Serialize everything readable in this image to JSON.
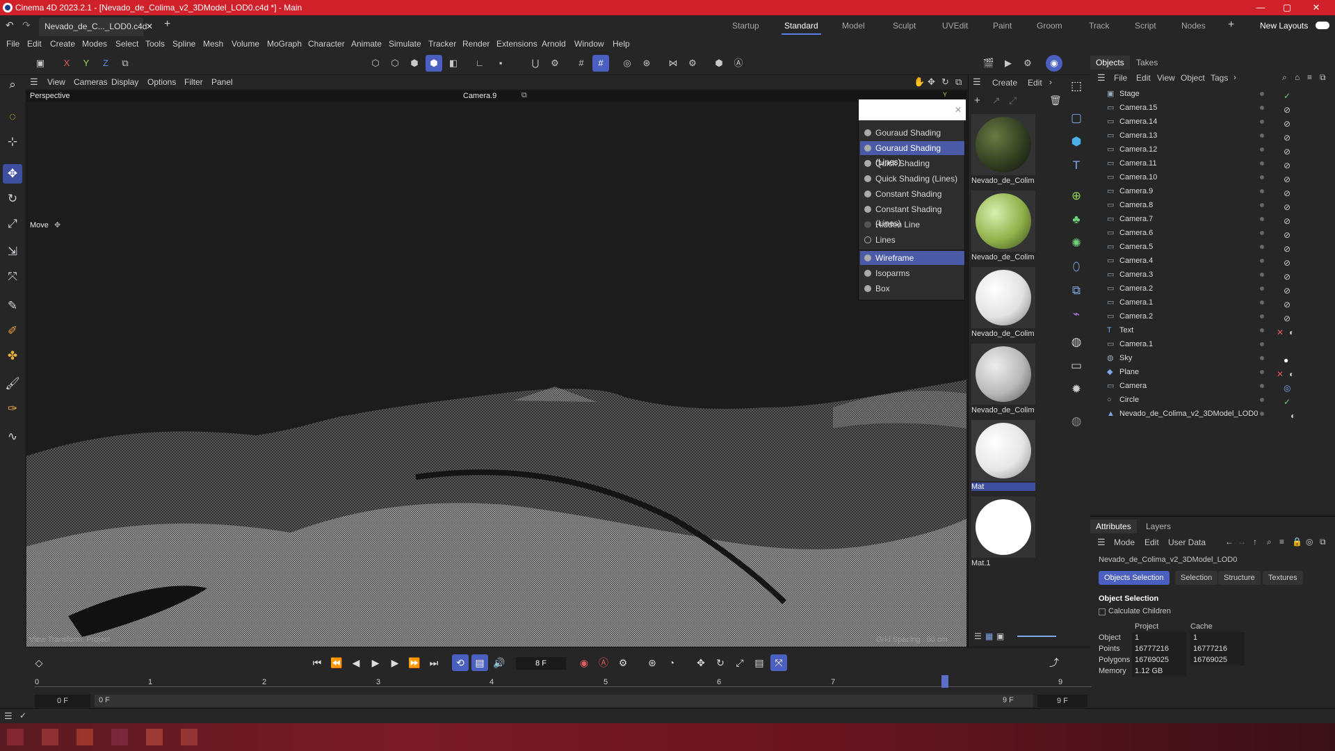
{
  "titlebar": {
    "title": "Cinema 4D 2023.2.1 - [Nevado_de_Colima_v2_3DModel_LOD0.c4d *] - Main"
  },
  "tabs": {
    "document": "Nevado_de_C..._LOD0.c4d *",
    "layouts": [
      "Startup",
      "Standard",
      "Model",
      "Sculpt",
      "UVEdit",
      "Paint",
      "Groom",
      "Track",
      "Script",
      "Nodes"
    ],
    "active_layout": "Standard",
    "new_layouts": "New Layouts"
  },
  "menu": [
    "File",
    "Edit",
    "Create",
    "Modes",
    "Select",
    "Tools",
    "Spline",
    "Mesh",
    "Volume",
    "MoGraph",
    "Character",
    "Animate",
    "Simulate",
    "Tracker",
    "Render",
    "Extensions",
    "Arnold",
    "Window",
    "Help"
  ],
  "axis": {
    "x": "X",
    "y": "Y",
    "z": "Z"
  },
  "viewport": {
    "menu": [
      "View",
      "Cameras",
      "Display",
      "Options",
      "Filter",
      "Panel"
    ],
    "view_name": "Perspective",
    "camera": "Camera.9",
    "tool": "Move",
    "bottom_left": "View Transform: Project",
    "bottom_right": "Grid Spacing : 50 cm"
  },
  "shading_menu": {
    "items": [
      "Gouraud Shading",
      "Gouraud Shading (Lines)",
      "Quick Shading",
      "Quick Shading (Lines)",
      "Constant Shading",
      "Constant Shading (Lines)",
      "Hidden Line",
      "Lines",
      "Wireframe",
      "Isoparms",
      "Box"
    ],
    "selected": [
      "Gouraud Shading (Lines)",
      "Wireframe"
    ]
  },
  "materials": {
    "menu": [
      "Create",
      "Edit"
    ],
    "items": [
      {
        "name": "Nevado_de_Colim",
        "color": "#3b4a2a"
      },
      {
        "name": "Nevado_de_Colim",
        "color": "#8fb04a"
      },
      {
        "name": "Nevado_de_Colim",
        "color": "#e2e2e2"
      },
      {
        "name": "Nevado_de_Colim",
        "color": "#b8b8b8"
      },
      {
        "name": "Mat",
        "color": "#f0f0f0"
      },
      {
        "name": "Mat.1",
        "color": "#ffffff"
      }
    ],
    "selected": "Mat"
  },
  "objects": {
    "tabs": [
      "Objects",
      "Takes"
    ],
    "menu": [
      "File",
      "Edit",
      "View",
      "Object",
      "Tags"
    ],
    "rows": [
      "Stage",
      "Camera.15",
      "Camera.14",
      "Camera.13",
      "Camera.12",
      "Camera.11",
      "Camera.10",
      "Camera.9",
      "Camera.8",
      "Camera.7",
      "Camera.6",
      "Camera.5",
      "Camera.4",
      "Camera.3",
      "Camera.2",
      "Camera.1",
      "Camera.2",
      "Text",
      "Camera.1",
      "Sky",
      "Plane",
      "Camera",
      "Circle",
      "Nevado_de_Colima_v2_3DModel_LOD0"
    ]
  },
  "attributes": {
    "tabs": [
      "Attributes",
      "Layers"
    ],
    "menu": [
      "Mode",
      "Edit",
      "User Data"
    ],
    "object_name": "Nevado_de_Colima_v2_3DModel_LOD0",
    "subtabs": [
      "Objects Selection",
      "Selection",
      "Structure",
      "Textures"
    ],
    "active_subtab": "Objects Selection",
    "section": "Object Selection",
    "checkbox": "Calculate Children",
    "col_project": "Project",
    "col_cache": "Cache",
    "rows": [
      {
        "label": "Object",
        "project": "1",
        "cache": "1"
      },
      {
        "label": "Points",
        "project": "16777216",
        "cache": "16777216"
      },
      {
        "label": "Polygons",
        "project": "16769025",
        "cache": "16769025"
      },
      {
        "label": "Memory",
        "project": "1.12 GB",
        "cache": ""
      }
    ]
  },
  "timeline": {
    "current_frame": "8 F",
    "ticks": [
      "0",
      "1",
      "2",
      "3",
      "4",
      "5",
      "6",
      "7",
      "8",
      "9"
    ],
    "start": "0 F",
    "min": "0 F",
    "max": "9 F",
    "end": "9 F",
    "playhead": 8
  },
  "colors": {
    "accent": "#4a5fbf",
    "titlebar": "#d0202a"
  }
}
